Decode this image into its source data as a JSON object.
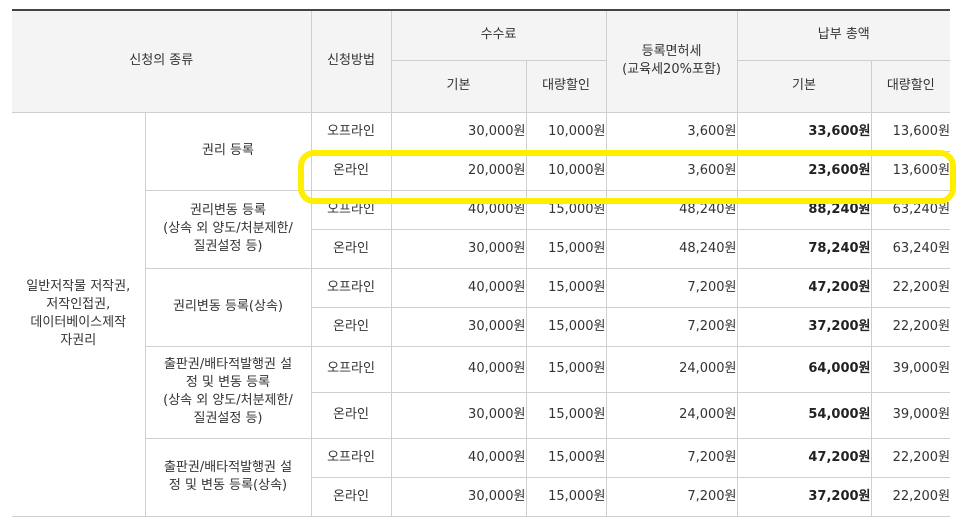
{
  "header": {
    "type": "신청의 종류",
    "method": "신청방법",
    "fee": "수수료",
    "fee_basic": "기본",
    "fee_bulk": "대량할인",
    "tax": "등록면허세",
    "tax_note": "(교육세20%포함)",
    "total": "납부 총액",
    "total_basic": "기본",
    "total_bulk": "대량할인"
  },
  "category": {
    "lines": [
      "일반저작물 저작권,",
      "저작인접권,",
      "데이터베이스제작",
      "자권리"
    ]
  },
  "groups": [
    {
      "name_lines": [
        "권리 등록"
      ],
      "rows": [
        {
          "method": "오프라인",
          "fee": "30,000원",
          "bulk": "10,000원",
          "tax": "3,600원",
          "total": "33,600원",
          "total_bulk": "13,600원"
        },
        {
          "method": "온라인",
          "fee": "20,000원",
          "bulk": "10,000원",
          "tax": "3,600원",
          "total": "23,600원",
          "total_bulk": "13,600원"
        }
      ]
    },
    {
      "name_lines": [
        "권리변동 등록",
        "(상속 외 양도/처분제한/",
        "질권설정 등)"
      ],
      "rows": [
        {
          "method": "오프라인",
          "fee": "40,000원",
          "bulk": "15,000원",
          "tax": "48,240원",
          "total": "88,240원",
          "total_bulk": "63,240원"
        },
        {
          "method": "온라인",
          "fee": "30,000원",
          "bulk": "15,000원",
          "tax": "48,240원",
          "total": "78,240원",
          "total_bulk": "63,240원"
        }
      ]
    },
    {
      "name_lines": [
        "권리변동 등록(상속)"
      ],
      "rows": [
        {
          "method": "오프라인",
          "fee": "40,000원",
          "bulk": "15,000원",
          "tax": "7,200원",
          "total": "47,200원",
          "total_bulk": "22,200원"
        },
        {
          "method": "온라인",
          "fee": "30,000원",
          "bulk": "15,000원",
          "tax": "7,200원",
          "total": "37,200원",
          "total_bulk": "22,200원"
        }
      ]
    },
    {
      "name_lines": [
        "출판권/배타적발행권 설",
        "정 및 변동 등록",
        "(상속 외 양도/처분제한/",
        "질권설정 등)"
      ],
      "rows": [
        {
          "method": "오프라인",
          "fee": "40,000원",
          "bulk": "15,000원",
          "tax": "24,000원",
          "total": "64,000원",
          "total_bulk": "39,000원"
        },
        {
          "method": "온라인",
          "fee": "30,000원",
          "bulk": "15,000원",
          "tax": "24,000원",
          "total": "54,000원",
          "total_bulk": "39,000원"
        }
      ]
    },
    {
      "name_lines": [
        "출판권/배타적발행권 설",
        "정 및 변동 등록(상속)"
      ],
      "rows": [
        {
          "method": "오프라인",
          "fee": "40,000원",
          "bulk": "15,000원",
          "tax": "7,200원",
          "total": "47,200원",
          "total_bulk": "22,200원"
        },
        {
          "method": "온라인",
          "fee": "30,000원",
          "bulk": "15,000원",
          "tax": "7,200원",
          "total": "37,200원",
          "total_bulk": "22,200원"
        }
      ]
    }
  ],
  "highlight": {
    "color": "#ffee00"
  }
}
